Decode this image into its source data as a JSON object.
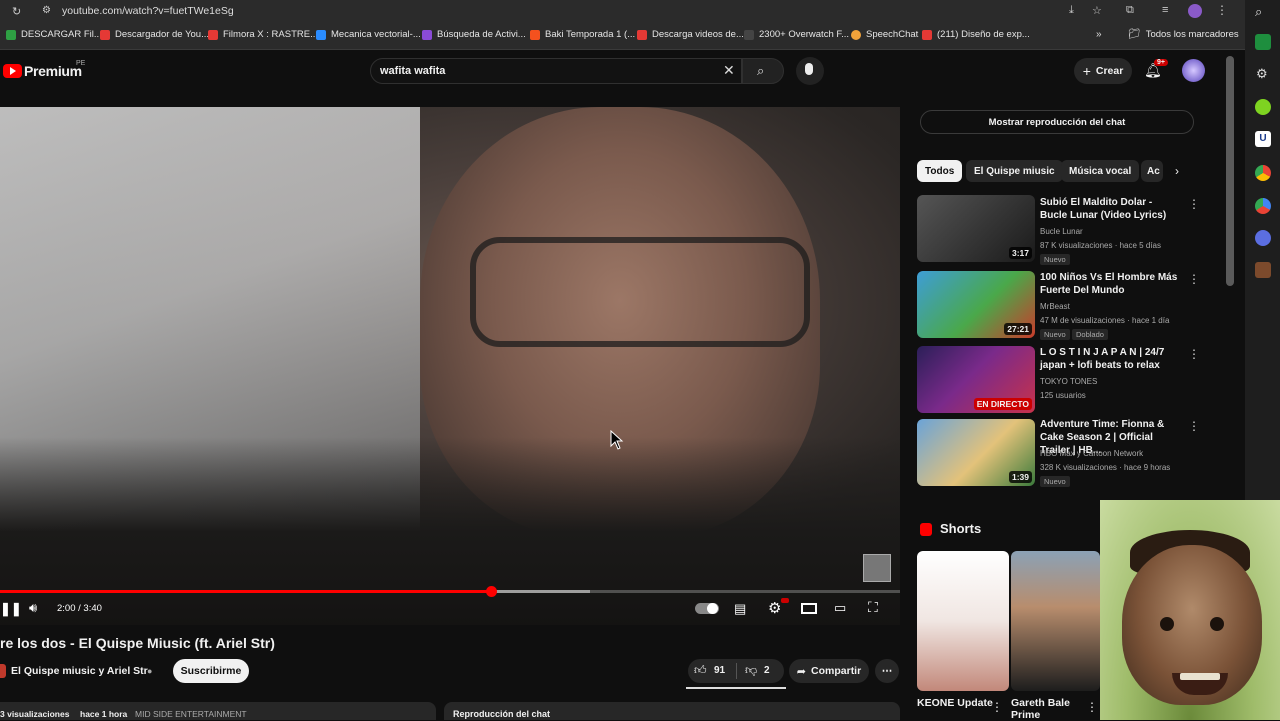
{
  "browser": {
    "url": "youtube.com/watch?v=fuetTWe1eSg",
    "bookmarks": [
      {
        "label": "DESCARGAR Fil...",
        "color": "#2ea043"
      },
      {
        "label": "Descargador de You...",
        "color": "#e53935"
      },
      {
        "label": "Filmora X : RASTRE...",
        "color": "#e53935"
      },
      {
        "label": "Mecanica vectorial-...",
        "color": "#2a8cff"
      },
      {
        "label": "Búsqueda de Activi...",
        "color": "#8a4bd6"
      },
      {
        "label": "Baki Temporada 1 (...",
        "color": "#f4511e"
      },
      {
        "label": "Descarga videos de...",
        "color": "#e53935"
      },
      {
        "label": "2300+ Overwatch F...",
        "color": "#444444"
      },
      {
        "label": "SpeechChat",
        "color": "#f2a33a"
      },
      {
        "label": "(211) Diseño de exp...",
        "color": "#e53935"
      }
    ],
    "all_bookmarks": "Todos los marcadores"
  },
  "header": {
    "logo_text": "Premium",
    "logo_region": "PE",
    "search_value": "wafita wafita",
    "create_label": "Crear",
    "notif_count": "9+"
  },
  "player": {
    "time": "2:00 / 3:40",
    "progress_fraction": 0.5455,
    "buffer_fraction": 0.6556
  },
  "video": {
    "title": "re los dos - El Quispe Miusic (ft. Ariel Str)",
    "channel": "El Quispe miusic y Ariel Str",
    "subscribe_label": "Suscribirme",
    "likes": "91",
    "dislikes": "2",
    "share_label": "Compartir",
    "views": "3 visualizaciones",
    "date": "hace 1 hora",
    "tag": "MID SIDE ENTERTAINMENT",
    "chat_replay_bottom": "Reproducción del chat"
  },
  "sidebar": {
    "chat_replay_button": "Mostrar reproducción del chat",
    "chips": [
      "Todos",
      "El Quispe miusic",
      "Música vocal",
      "Ac"
    ],
    "videos": [
      {
        "title": "Subió El Maldito Dolar - Bucle Lunar (Video Lyrics)",
        "channel": "Bucle Lunar",
        "meta": "87 K visualizaciones · hace 5 días",
        "badge": "Nuevo",
        "duration": "3:17",
        "thumb_color": "#3a3a3a"
      },
      {
        "title": "100 Niños Vs El Hombre Más Fuerte Del Mundo",
        "channel": "MrBeast",
        "meta": "47 M de visualizaciones · hace 1 día",
        "badge": "Nuevo",
        "badge2": "Doblado",
        "duration": "27:21",
        "thumb_color": "#4aa84a"
      },
      {
        "title": "L O S T   I N   J A P A N | 24/7 japan + lofi beats to relax",
        "channel": "TOKYO TONES",
        "meta": "125 usuarios",
        "live": "EN DIRECTO",
        "thumb_color": "#5b2f8c"
      },
      {
        "title": "Adventure Time: Fionna & Cake Season 2 | Official Trailer | HB...",
        "channel": "HBO Max y Cartoon Network",
        "meta": "328 K visualizaciones · hace 9 horas",
        "badge": "Nuevo",
        "duration": "1:39",
        "thumb_color": "#c69a5e"
      }
    ],
    "shorts_label": "Shorts",
    "shorts": [
      {
        "title": "KEONE Update"
      },
      {
        "title": "Gareth Bale Prime"
      }
    ]
  }
}
